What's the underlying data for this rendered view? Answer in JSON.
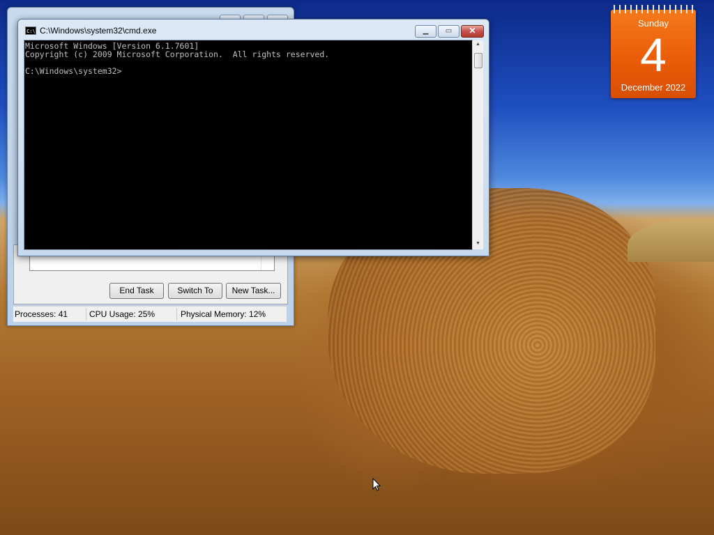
{
  "calendar": {
    "weekday": "Sunday",
    "day": "4",
    "month_year": "December 2022",
    "color": "#f06a12"
  },
  "cmd": {
    "title": "C:\\Windows\\system32\\cmd.exe",
    "icon": "cmd-icon",
    "icon_text": "C:\\",
    "console_text": "Microsoft Windows [Version 6.1.7601]\nCopyright (c) 2009 Microsoft Corporation.  All rights reserved.\n\nC:\\Windows\\system32>",
    "minimize": "▁",
    "maximize": "▭",
    "close": "✕"
  },
  "taskmgr": {
    "buttons": {
      "end_task": "End Task",
      "switch_to": "Switch To",
      "new_task": "New Task..."
    },
    "status": {
      "processes": "Processes: 41",
      "cpu": "CPU Usage: 25%",
      "memory": "Physical Memory: 12%"
    }
  }
}
